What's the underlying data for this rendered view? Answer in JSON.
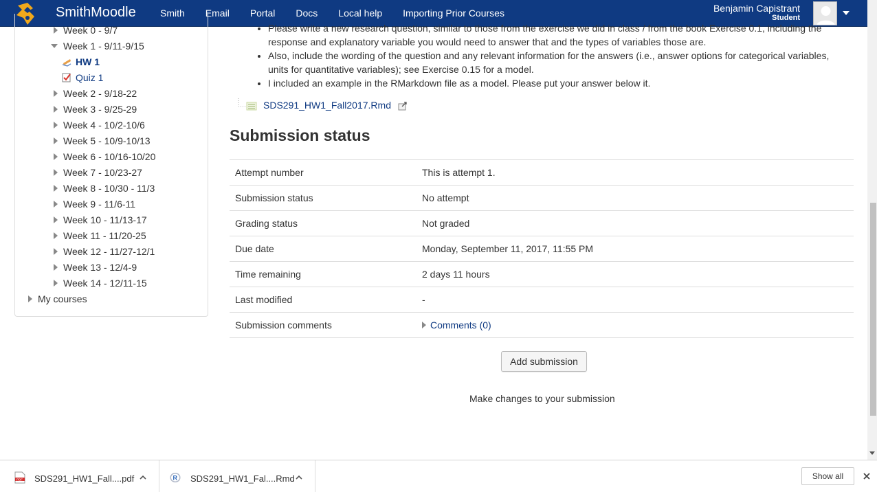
{
  "navbar": {
    "brand": "SmithMoodle",
    "links": [
      "Smith",
      "Email",
      "Portal",
      "Docs",
      "Local help",
      "Importing Prior Courses"
    ],
    "user_name": "Benjamin Capistrant",
    "user_role": "Student",
    "bg_color": "#0f3a82"
  },
  "nav_tree": {
    "week0": "Week 0 - 9/7",
    "week1": "Week 1 - 9/11-9/15",
    "hw1": "HW 1",
    "quiz1": "Quiz 1",
    "weeks": [
      "Week 2 - 9/18-22",
      "Week 3 - 9/25-29",
      "Week 4 - 10/2-10/6",
      "Week 5 - 10/9-10/13",
      "Week 6 - 10/16-10/20",
      "Week 7 - 10/23-27",
      "Week 8 - 10/30 - 11/3",
      "Week 9 - 11/6-11",
      "Week 10 - 11/13-17",
      "Week 11 - 11/20-25",
      "Week 12 - 11/27-12/1",
      "Week 13 - 12/4-9",
      "Week 14 - 12/11-15"
    ],
    "my_courses": "My courses"
  },
  "instructions": {
    "bullet1": "Please write a new research question, similar to those from the exercise we did in class / from the book Exercise 0.1, including the response and explanatory variable you would need to answer that and the types of variables those are.",
    "bullet2": "Also, include the wording of the question and any relevant information for the answers (i.e., answer options for categorical variables, units for quantitative variables); see Exercise 0.15 for a model.",
    "bullet3": "I included an example in the RMarkdown file as a model. Please put your answer below it."
  },
  "attachment": {
    "file_name": "SDS291_HW1_Fall2017.Rmd"
  },
  "submission": {
    "heading": "Submission status",
    "rows": [
      {
        "label": "Attempt number",
        "value": "This is attempt 1."
      },
      {
        "label": "Submission status",
        "value": "No attempt"
      },
      {
        "label": "Grading status",
        "value": "Not graded"
      },
      {
        "label": "Due date",
        "value": "Monday, September 11, 2017, 11:55 PM"
      },
      {
        "label": "Time remaining",
        "value": "2 days 11 hours"
      },
      {
        "label": "Last modified",
        "value": "-"
      },
      {
        "label": "Submission comments",
        "value": "Comments (0)"
      }
    ],
    "add_button": "Add submission",
    "make_changes": "Make changes to your submission"
  },
  "downloads": {
    "items": [
      {
        "name": "SDS291_HW1_Fall....pdf",
        "icon": "pdf-file-icon"
      },
      {
        "name": "SDS291_HW1_Fal....Rmd",
        "icon": "r-file-icon"
      }
    ],
    "show_all": "Show all"
  }
}
